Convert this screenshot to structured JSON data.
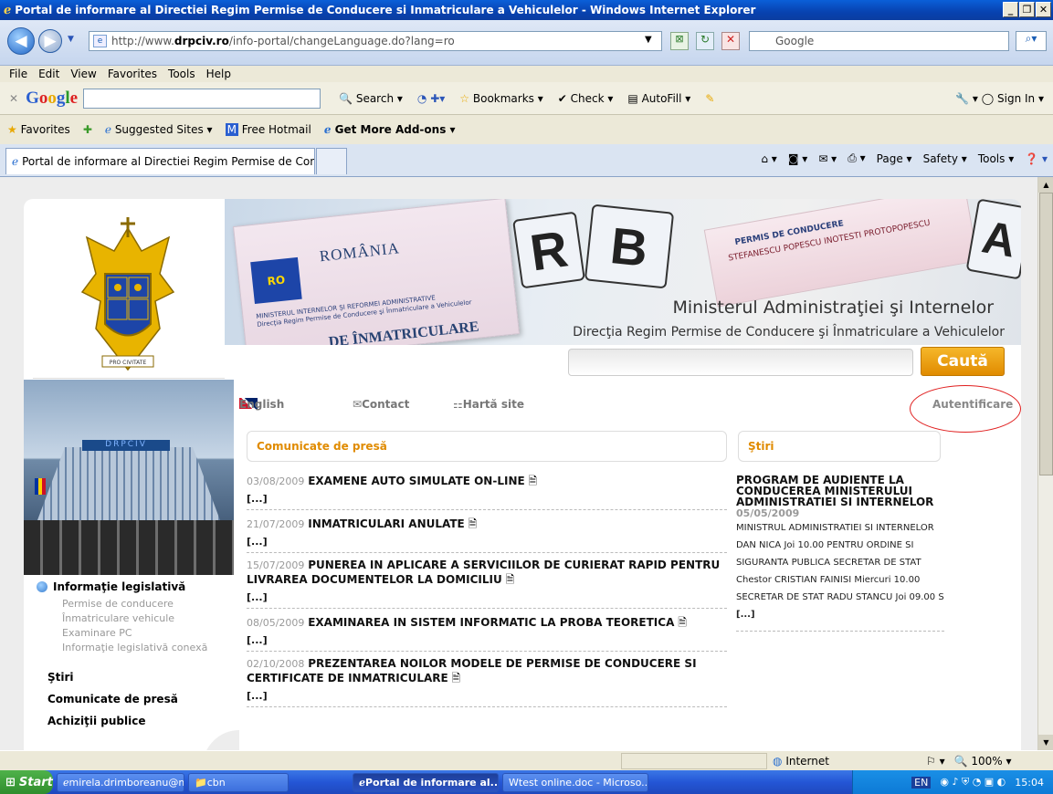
{
  "window": {
    "title": "Portal de informare al Directiei Regim Permise de Conducere si Inmatriculare a Vehiculelor - Windows Internet Explorer"
  },
  "address": {
    "url_prefix": "http://www.",
    "url_domain": "drpciv.ro",
    "url_path": "/info-portal/changeLanguage.do?lang=ro",
    "search_placeholder": "Google"
  },
  "menubar": [
    "File",
    "Edit",
    "View",
    "Favorites",
    "Tools",
    "Help"
  ],
  "google_bar": {
    "logo": "Google",
    "search": "Search",
    "bookmarks": "Bookmarks",
    "check": "Check",
    "autofill": "AutoFill",
    "signin": "Sign In"
  },
  "favorites": {
    "label": "Favorites",
    "items": [
      "Suggested Sites",
      "Free Hotmail",
      "Get More Add-ons"
    ]
  },
  "tab": {
    "title": "Portal de informare al Directiei Regim Permise de Cond..."
  },
  "commandbar": [
    "Page",
    "Safety",
    "Tools"
  ],
  "banner": {
    "romania": "ROMÂNIA",
    "eu": "RO",
    "ministry_small": "MINISTERUL INTERNELOR ŞI REFORMEI ADMINISTRATIVE",
    "dir_small": "Direcţia Regim Permise de Conducere şi Înmatriculare a Vehiculelor",
    "inmatriculare": "DE ÎNMATRICULARE",
    "licence": "PERMIS DE CONDUCERE",
    "lic_names": "STEFANESCU POPESCU INOTESTI PROTOPOPESCU",
    "ministry": "Ministerul Administraţiei şi Internelor",
    "directia": "Direcţia Regim Permise de Conducere şi Înmatriculare a Vehiculelor",
    "plate_letters": [
      "R",
      "B",
      "A"
    ]
  },
  "crest": {
    "motto": "PRO CIVITATE"
  },
  "building_sign": "DRPCIV",
  "search": {
    "button": "Caută"
  },
  "toplinks": {
    "english": "English",
    "contact": "Contact",
    "sitemap": "Hartă site",
    "login": "Autentificare"
  },
  "sidebar": {
    "legislative": "Informaţie legislativă",
    "sub": [
      "Permise de conducere",
      "Înmatriculare vehicule",
      "Examinare PC",
      "Informaţie legislativă conexă"
    ],
    "main": [
      "Ştiri",
      "Comunicate de presă",
      "Achiziţii publice"
    ]
  },
  "press": {
    "title": "Comunicate de presă",
    "items": [
      {
        "date": "03/08/2009",
        "title": "EXAMENE AUTO SIMULATE ON-LINE",
        "more": "[...]"
      },
      {
        "date": "21/07/2009",
        "title": "INMATRICULARI ANULATE",
        "more": "[...]"
      },
      {
        "date": "15/07/2009",
        "title": "PUNEREA IN APLICARE A SERVICIILOR DE CURIERAT RAPID PENTRU LIVRAREA DOCUMENTELOR LA DOMICILIU",
        "more": "[...]"
      },
      {
        "date": "08/05/2009",
        "title": "EXAMINAREA IN SISTEM INFORMATIC LA PROBA TEORETICA",
        "more": "[...]"
      },
      {
        "date": "02/10/2008",
        "title": "PREZENTAREA NOILOR MODELE DE PERMISE DE CONDUCERE SI CERTIFICATE DE INMATRICULARE",
        "more": "[...]"
      }
    ]
  },
  "news": {
    "title": "Ştiri",
    "item": {
      "title": "PROGRAM DE AUDIENTE LA CONDUCEREA MINISTERULUI ADMINISTRATIEI SI INTERNELOR",
      "date": "05/05/2009",
      "body": "MINISTRUL ADMINISTRATIEI SI INTERNELOR DAN NICA Joi 10.00 PENTRU ORDINE SI SIGURANTA PUBLICA SECRETAR DE STAT Chestor CRISTIAN FAINISI Miercuri 10.00 SECRETAR DE STAT RADU STANCU Joi 09.00 S",
      "more": "[...]"
    }
  },
  "statusbar": {
    "zone": "Internet",
    "zoom": "100%"
  },
  "taskbar": {
    "start": "Start",
    "items": [
      "mirela.drimboreanu@mai...",
      "cbn",
      "Portal de informare al...",
      "test online.doc - Microso..."
    ],
    "lang": "EN",
    "clock": "15:04"
  }
}
